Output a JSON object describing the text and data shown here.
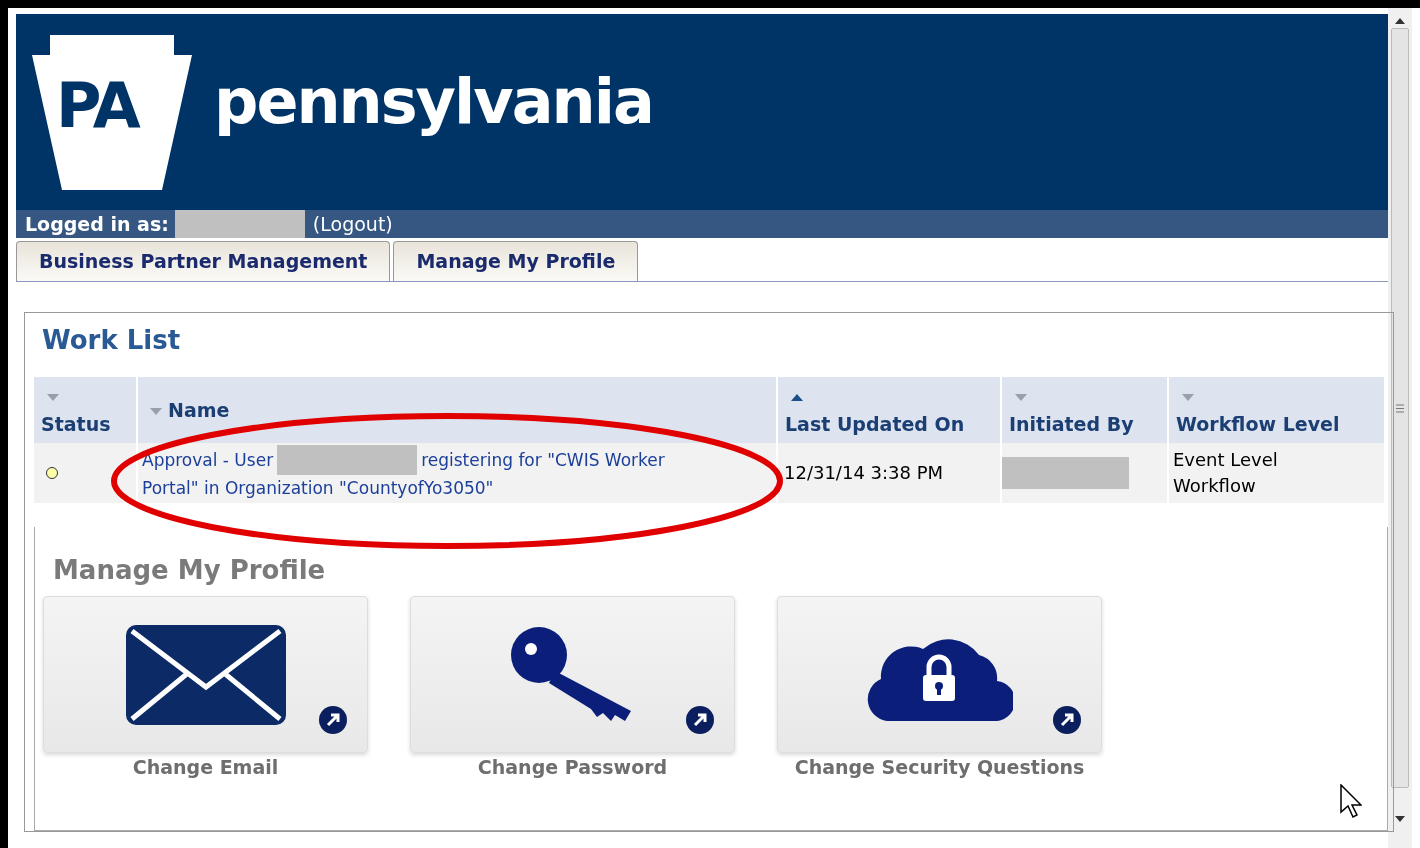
{
  "header": {
    "logo_text": "PA",
    "site_name": "pennsylvania"
  },
  "login_bar": {
    "label": "Logged in as:",
    "logout": "(Logout)"
  },
  "tabs": [
    {
      "label": "Business Partner Management",
      "selected": false
    },
    {
      "label": "Manage My Profile",
      "selected": false
    }
  ],
  "work_list": {
    "title": "Work List",
    "columns": [
      {
        "label": "Status",
        "sorted": false
      },
      {
        "label": "Name",
        "sorted": false
      },
      {
        "label": "Last Updated On",
        "sorted": true
      },
      {
        "label": "Initiated By",
        "sorted": false
      },
      {
        "label": "Workflow Level",
        "sorted": false
      }
    ],
    "rows": [
      {
        "color": "#ffffaa",
        "name_start": "Approval - User",
        "name_line1_end": "registering for \"CWIS Worker",
        "name_line2": "Portal\" in Organization \"CountyofYo3050\"",
        "last_updated": "12/31/14 3:38 PM",
        "workflow_level": "Event Level Workflow"
      }
    ]
  },
  "profile": {
    "title": "Manage My Profile",
    "tiles": [
      {
        "kind": "email",
        "label": "Change Email"
      },
      {
        "kind": "password",
        "label": "Change Password"
      },
      {
        "kind": "security",
        "label": "Change Security Questions"
      }
    ]
  }
}
